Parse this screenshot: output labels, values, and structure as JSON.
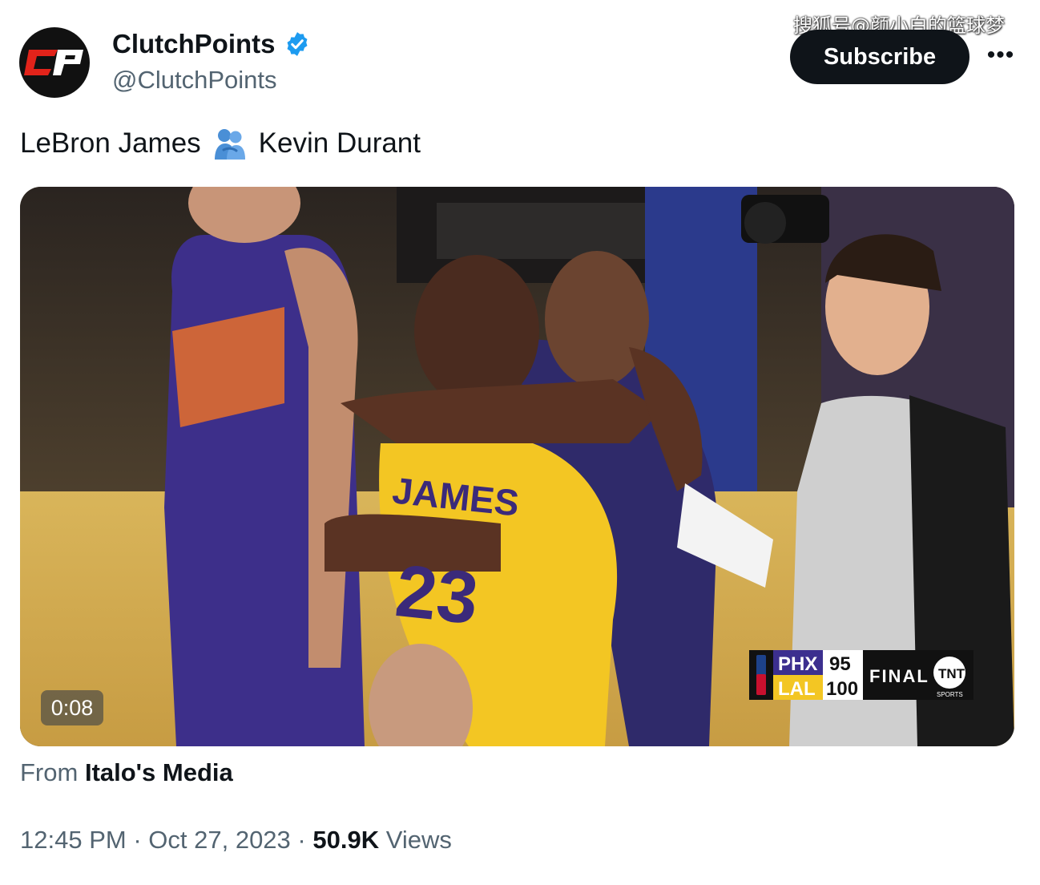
{
  "watermark": "搜狐号@颜小白的篮球梦",
  "author": {
    "display_name": "ClutchPoints",
    "handle": "@ClutchPoints",
    "avatar_text": "CP",
    "verified_icon": "verified-badge-icon"
  },
  "actions": {
    "subscribe_label": "Subscribe",
    "more_label": "•••"
  },
  "tweet": {
    "text_before": "LeBron James",
    "emoji": "people-hugging-emoji",
    "text_after": "Kevin Durant"
  },
  "video": {
    "duration": "0:08",
    "jersey_name": "JAMES",
    "jersey_number": "23",
    "scorebug": {
      "team1": "PHX",
      "score1": "95",
      "team2": "LAL",
      "score2": "100",
      "status": "FINAL",
      "network": "TNT",
      "network_sub": "SPORTS"
    }
  },
  "source": {
    "prefix": "From",
    "name": "Italo's Media"
  },
  "meta": {
    "time": "12:45 PM",
    "separator": "·",
    "date": "Oct 27, 2023",
    "views_count": "50.9K",
    "views_label": "Views"
  },
  "colors": {
    "text": "#0f1419",
    "muted": "#536471",
    "verified": "#1d9bf0",
    "lakers_gold": "#f3c623",
    "suns_purple": "#3c2f8f"
  }
}
